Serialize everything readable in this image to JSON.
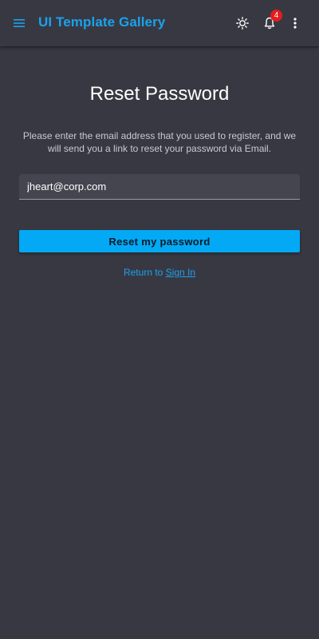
{
  "app_bar": {
    "title": "UI Template Gallery",
    "menu_icon": "menu-icon",
    "theme_icon": "sun-icon",
    "notifications_icon": "bell-icon",
    "notifications_count": "4",
    "more_icon": "more-vertical-icon"
  },
  "reset": {
    "title": "Reset Password",
    "instructions": "Please enter the email address that you used to register, and we will send you a link to reset your password via Email.",
    "email_value": "jheart@corp.com",
    "button_label": "Reset my password",
    "return_prefix": "Return to ",
    "signin_label": "Sign In"
  },
  "colors": {
    "background": "#383843",
    "accent": "#1aa3ea",
    "button": "#03a9f4",
    "badge": "#e51c1c"
  }
}
